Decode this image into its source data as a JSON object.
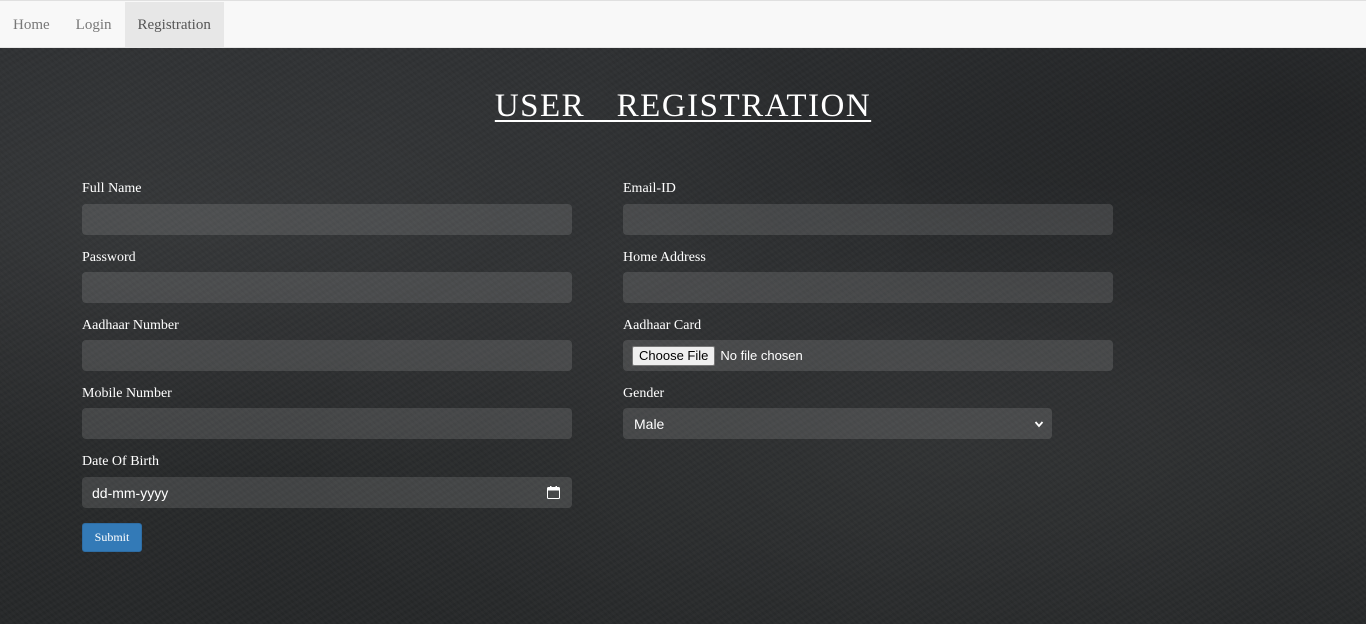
{
  "nav": {
    "items": [
      {
        "label": "Home"
      },
      {
        "label": "Login"
      },
      {
        "label": "Registration"
      }
    ]
  },
  "page": {
    "title": "USER  REGISTRATION"
  },
  "form": {
    "full_name": {
      "label": "Full Name",
      "value": ""
    },
    "email": {
      "label": "Email-ID",
      "value": ""
    },
    "password": {
      "label": "Password",
      "value": ""
    },
    "home_address": {
      "label": "Home Address",
      "value": ""
    },
    "aadhaar_number": {
      "label": "Aadhaar Number",
      "value": ""
    },
    "aadhaar_card": {
      "label": "Aadhaar Card",
      "button": "Choose File",
      "status": "No file chosen"
    },
    "mobile_number": {
      "label": "Mobile Number",
      "value": ""
    },
    "gender": {
      "label": "Gender",
      "selected": "Male"
    },
    "dob": {
      "label": "Date Of Birth",
      "placeholder": "dd-mm-yyyy"
    },
    "submit": "Submit"
  },
  "icons": {
    "calendar": "calendar-icon",
    "dropdown": "chevron-down-icon"
  }
}
